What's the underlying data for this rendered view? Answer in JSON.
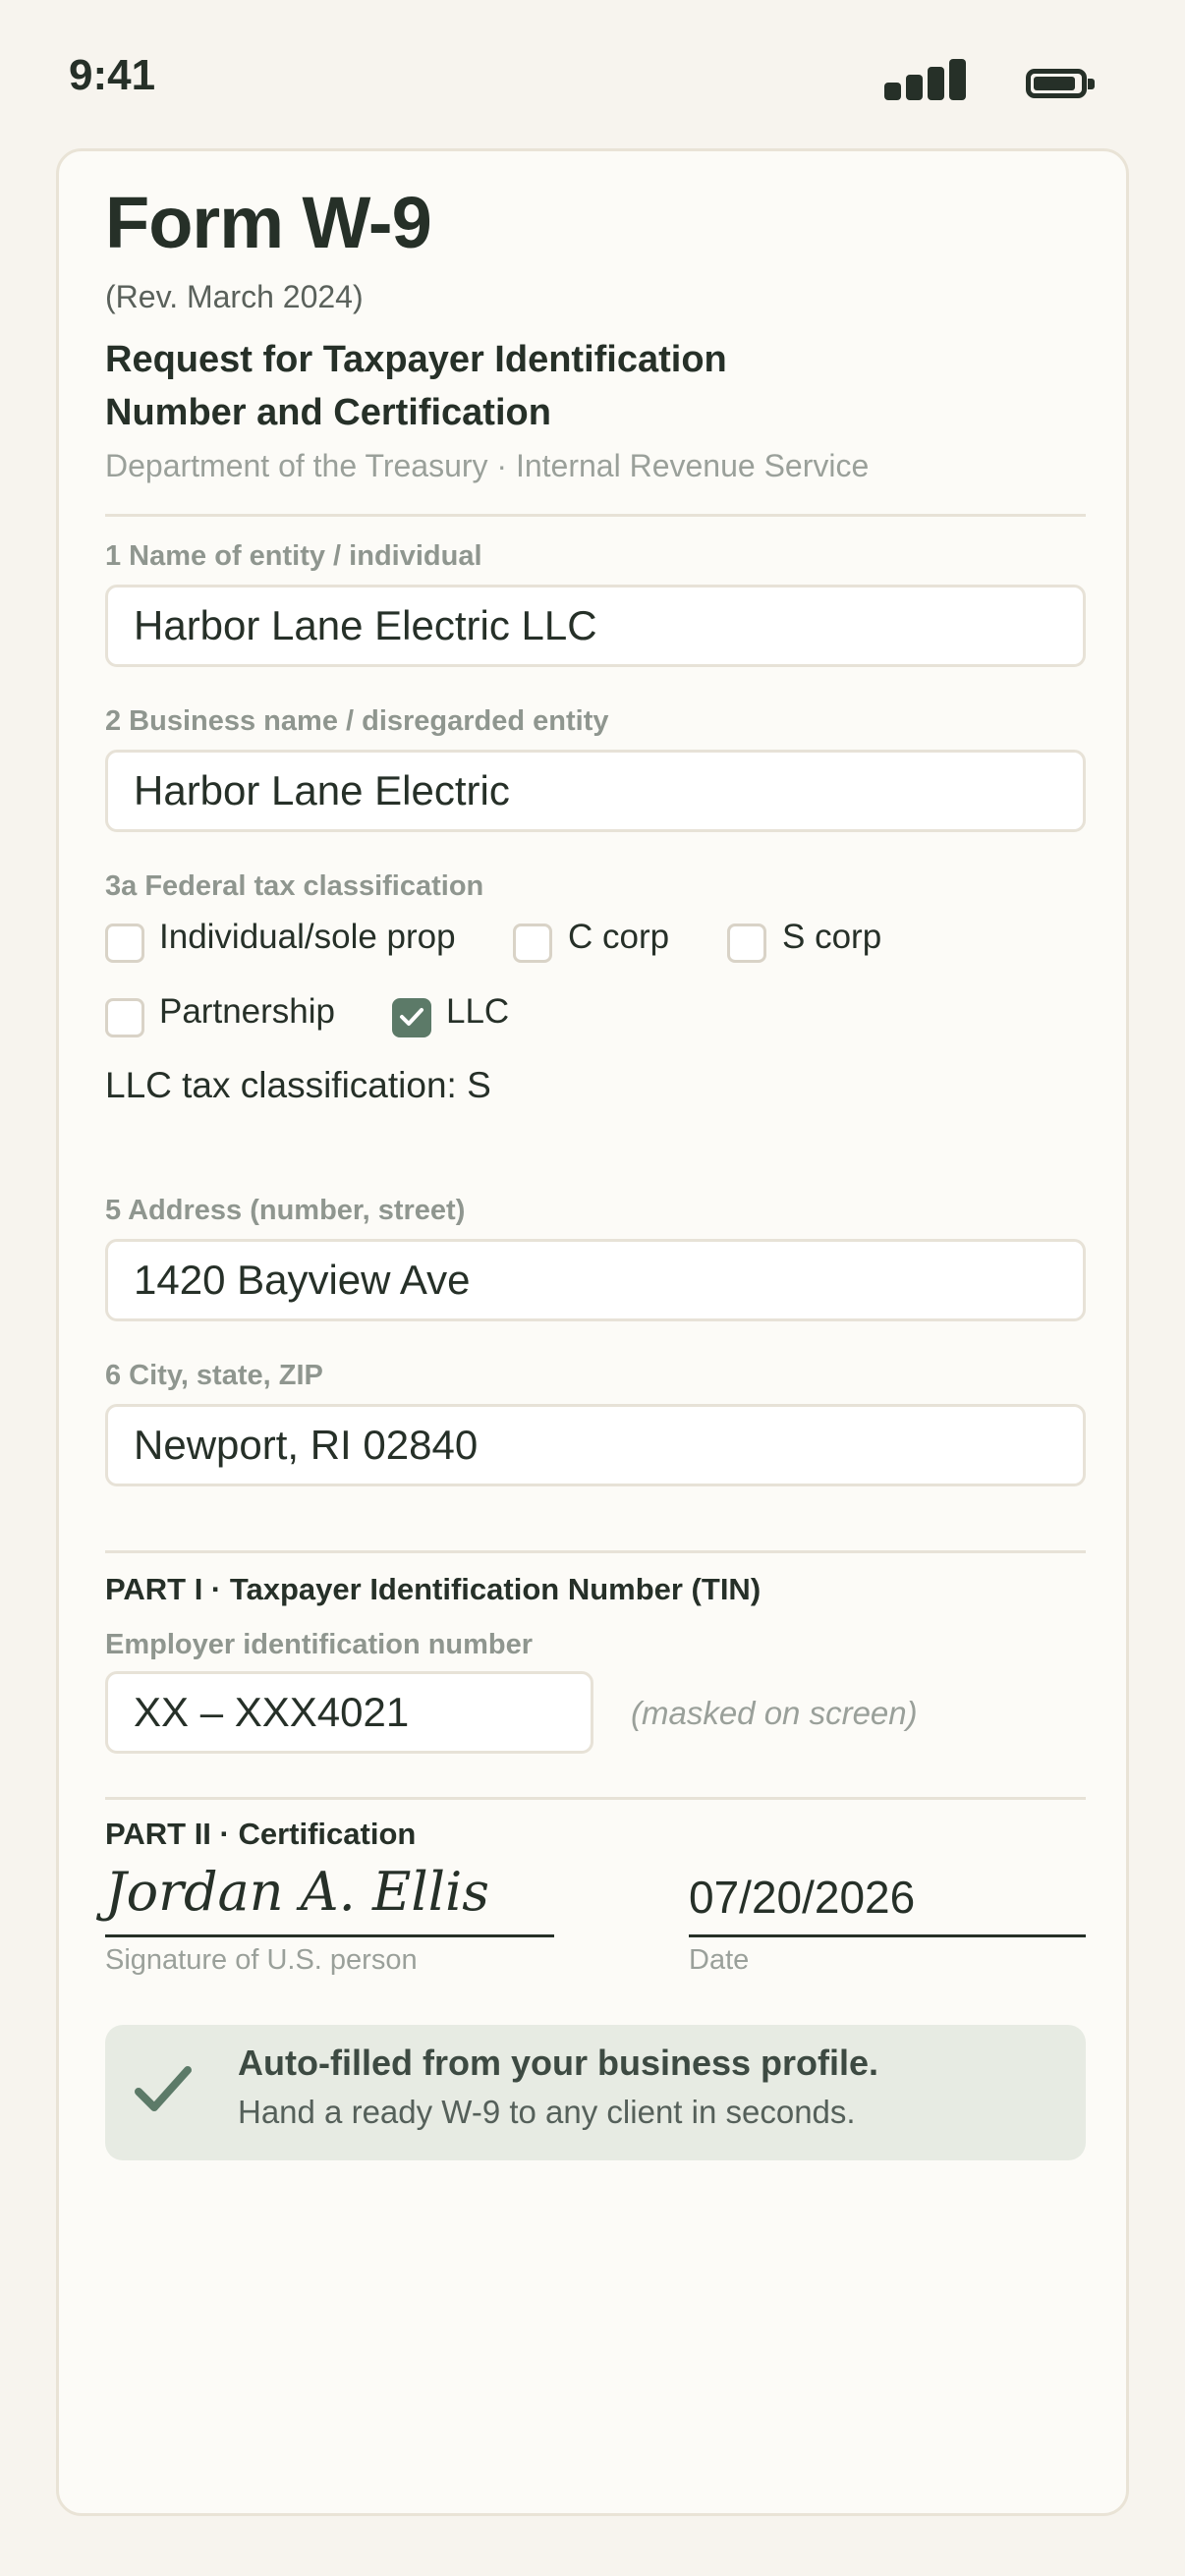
{
  "status_bar": {
    "time": "9:41"
  },
  "form": {
    "title": "Form W-9",
    "revision": "(Rev. March 2024)",
    "subtitle_line1": "Request for Taxpayer Identification",
    "subtitle_line2": "Number and Certification",
    "department": "Department of the Treasury · Internal Revenue Service"
  },
  "fields": {
    "name": {
      "label": "1  Name of entity / individual",
      "value": "Harbor Lane Electric LLC"
    },
    "business": {
      "label": "2  Business name / disregarded entity",
      "value": "Harbor Lane Electric"
    },
    "address": {
      "label": "5  Address (number, street)",
      "value": "1420 Bayview Ave"
    },
    "city": {
      "label": "6  City, state, ZIP",
      "value": "Newport, RI 02840"
    }
  },
  "classification": {
    "label": "3a  Federal tax classification",
    "options": [
      {
        "label": "Individual/sole prop",
        "checked": false
      },
      {
        "label": "C corp",
        "checked": false
      },
      {
        "label": "S corp",
        "checked": false
      },
      {
        "label": "Partnership",
        "checked": false
      },
      {
        "label": "LLC",
        "checked": true
      }
    ],
    "llc_tax_classification": "LLC tax classification:  S"
  },
  "part1": {
    "title": "PART I  ·  Taxpayer Identification Number (TIN)",
    "ein_label": "Employer identification number",
    "ein_value": "XX – XXX4021",
    "masked_note": "(masked on screen)"
  },
  "part2": {
    "title": "PART II  ·  Certification",
    "signature": "Jordan A. Ellis",
    "signature_caption": "Signature of U.S. person",
    "date": "07/20/2026",
    "date_caption": "Date"
  },
  "banner": {
    "title": "Auto-filled from your business profile.",
    "subtitle": "Hand a ready W-9 to any client in seconds."
  },
  "colors": {
    "accent": "#5c7a68",
    "background": "#f7f4ee",
    "card": "#fcfbf7",
    "text": "#263028"
  }
}
